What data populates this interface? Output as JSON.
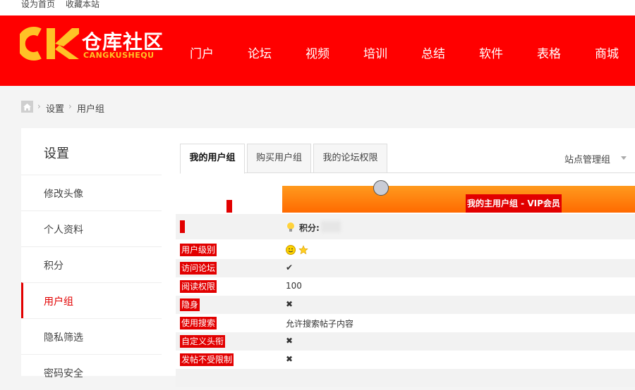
{
  "topbar": {
    "links": [
      "设为首页",
      "收藏本站"
    ]
  },
  "logo": {
    "cn": "仓库社区",
    "en": "CANGKUSHEQU"
  },
  "nav": [
    "门户",
    "论坛",
    "视频",
    "培训",
    "总结",
    "软件",
    "表格",
    "商城"
  ],
  "breadcrumb": {
    "items": [
      "设置",
      "用户组"
    ],
    "separator": "›"
  },
  "sidebar": {
    "title": "设置",
    "items": [
      "修改头像",
      "个人资料",
      "积分",
      "用户组",
      "隐私筛选",
      "密码安全"
    ],
    "active_index": 3
  },
  "tabs": [
    "我的用户组",
    "购买用户组",
    "我的论坛权限"
  ],
  "admin_link": "站点管理组",
  "group_header": "我的主用户组 - VIP会员",
  "score_label": "积分:",
  "rows": [
    {
      "label": "用户级别",
      "value": "",
      "icon": "smiley-star-icon"
    },
    {
      "label": "访问论坛",
      "value": "",
      "icon": "check-icon"
    },
    {
      "label": "阅读权限",
      "value": "100",
      "icon": ""
    },
    {
      "label": "隐身",
      "value": "",
      "icon": "cross-icon"
    },
    {
      "label": "使用搜索",
      "value": "允许搜索帖子内容",
      "icon": ""
    },
    {
      "label": "自定义头衔",
      "value": "",
      "icon": "cross-icon"
    },
    {
      "label": "发帖不受限制",
      "value": "",
      "icon": "cross-icon"
    }
  ],
  "colors": {
    "brand_red": "#ff0000",
    "accent_orange": "#ff7a00",
    "logo_yellow": "#ffc226",
    "active_red": "#e20000"
  }
}
